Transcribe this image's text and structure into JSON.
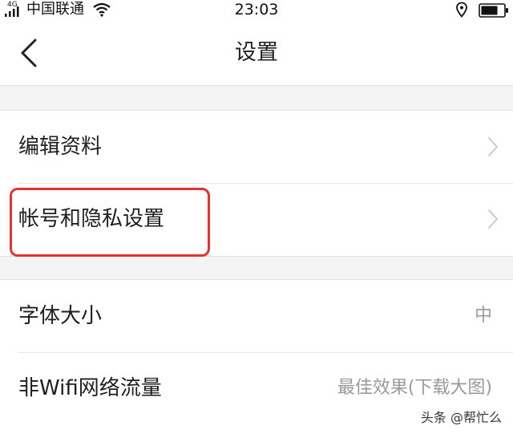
{
  "status_bar": {
    "network": "4G",
    "carrier": "中国联通",
    "time": "23:03"
  },
  "nav": {
    "title": "设置"
  },
  "settings": {
    "group1": [
      {
        "label": "编辑资料"
      },
      {
        "label": "帐号和隐私设置"
      }
    ],
    "group2": [
      {
        "label": "字体大小",
        "value": "中"
      },
      {
        "label": "非Wifi网络流量",
        "value": "最佳效果(下载大图)"
      }
    ]
  },
  "annotation": {
    "highlight_color": "#e8312f"
  },
  "watermark": {
    "text": "头条 @帮忙么"
  }
}
